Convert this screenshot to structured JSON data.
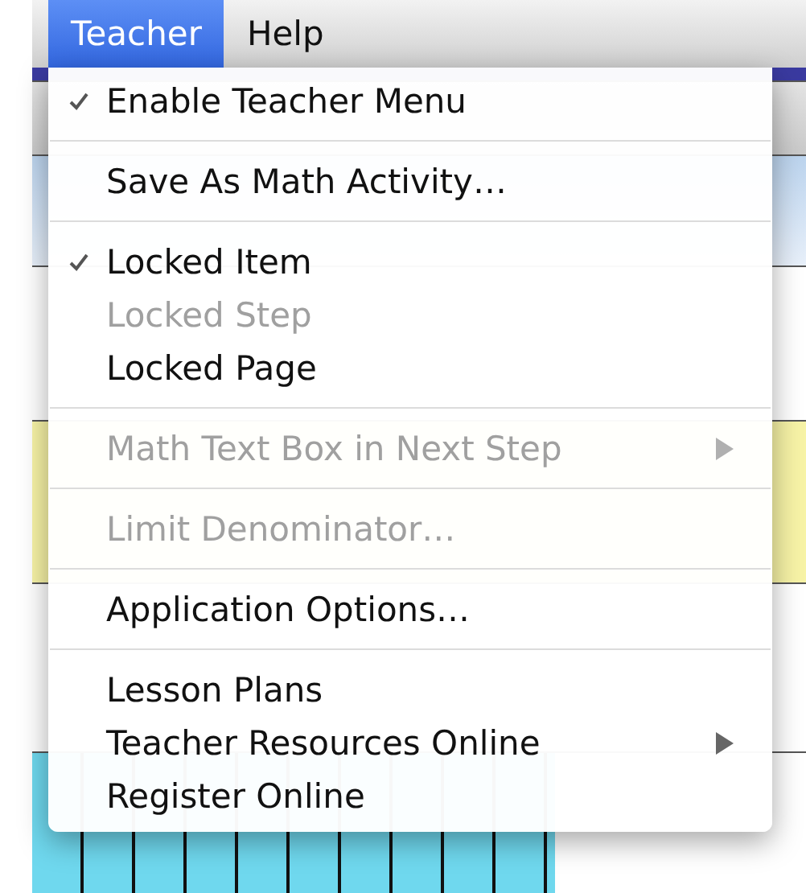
{
  "menu_bar": [
    {
      "label": "Teacher",
      "selected": true
    },
    {
      "label": "Help",
      "selected": false
    }
  ],
  "menu": [
    {
      "kind": "item",
      "label": "Enable Teacher Menu",
      "checked": true,
      "disabled": false,
      "submenu": false
    },
    {
      "kind": "separator"
    },
    {
      "kind": "item",
      "label": "Save As Math Activity…",
      "checked": false,
      "disabled": false,
      "submenu": false
    },
    {
      "kind": "separator"
    },
    {
      "kind": "item",
      "label": "Locked Item",
      "checked": true,
      "disabled": false,
      "submenu": false
    },
    {
      "kind": "item",
      "label": "Locked Step",
      "checked": false,
      "disabled": true,
      "submenu": false
    },
    {
      "kind": "item",
      "label": "Locked Page",
      "checked": false,
      "disabled": false,
      "submenu": false
    },
    {
      "kind": "separator"
    },
    {
      "kind": "item",
      "label": "Math Text Box in Next Step",
      "checked": false,
      "disabled": true,
      "submenu": true
    },
    {
      "kind": "separator"
    },
    {
      "kind": "item",
      "label": "Limit Denominator…",
      "checked": false,
      "disabled": true,
      "submenu": false
    },
    {
      "kind": "separator"
    },
    {
      "kind": "item",
      "label": "Application Options…",
      "checked": false,
      "disabled": false,
      "submenu": false
    },
    {
      "kind": "separator"
    },
    {
      "kind": "item",
      "label": "Lesson Plans",
      "checked": false,
      "disabled": false,
      "submenu": false
    },
    {
      "kind": "item",
      "label": "Teacher Resources Online",
      "checked": false,
      "disabled": false,
      "submenu": true
    },
    {
      "kind": "item",
      "label": "Register Online",
      "checked": false,
      "disabled": false,
      "submenu": false
    }
  ]
}
